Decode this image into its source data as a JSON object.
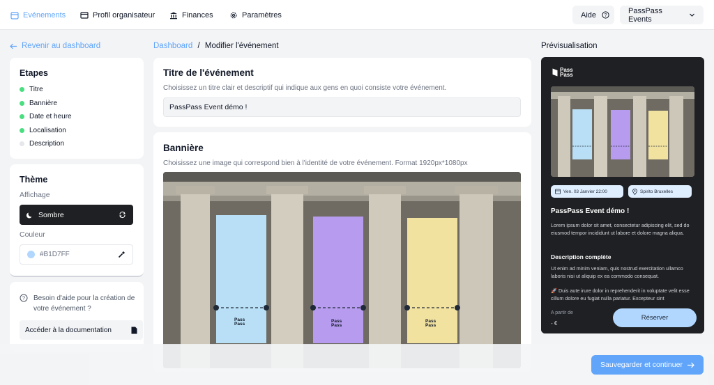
{
  "nav": {
    "items": [
      {
        "label": "Evénements",
        "icon": "calendar-icon",
        "active": true
      },
      {
        "label": "Profil organisateur",
        "icon": "profile-card-icon",
        "active": false
      },
      {
        "label": "Finances",
        "icon": "bank-icon",
        "active": false
      },
      {
        "label": "Paramètres",
        "icon": "gear-icon",
        "active": false
      }
    ],
    "help_label": "Aide",
    "account_label": "PassPass Events"
  },
  "sidebar": {
    "back_label": "Revenir au dashboard",
    "steps_title": "Etapes",
    "steps": [
      {
        "label": "Titre",
        "done": true
      },
      {
        "label": "Bannière",
        "done": true
      },
      {
        "label": "Date et heure",
        "done": true
      },
      {
        "label": "Localisation",
        "done": true
      },
      {
        "label": "Description",
        "done": false
      }
    ],
    "theme_title": "Thème",
    "display_label": "Affichage",
    "display_value": "Sombre",
    "color_label": "Couleur",
    "color_value": "#B1D7FF",
    "help_text": "Besoin d'aide pour la création de votre événement ?",
    "doc_button_label": "Accéder à la documentation"
  },
  "breadcrumb": {
    "link": "Dashboard",
    "separator": "/",
    "current": "Modifier l'événement"
  },
  "title_section": {
    "heading": "Titre de l'événement",
    "description": "Choisissez un titre clair et descriptif qui indique aux gens en quoi consiste votre événement.",
    "input_value": "PassPass Event démo !"
  },
  "banner_section": {
    "heading": "Bannière",
    "description": "Choisissez une image qui correspond bien à l'identité de votre événement. Format 1920px*1080px",
    "logo_text_1": "Pass",
    "logo_text_2": "Pass"
  },
  "preview": {
    "heading": "Prévisualisation",
    "logo_text_1": "Pass",
    "logo_text_2": "Pass",
    "date_chip": "Ven. 03 Janvier 22:00",
    "location_chip": "Spirito Bruxelles",
    "event_title": "PassPass Event démo !",
    "intro": "Lorem ipsum dolor sit amet, consectetur adipiscing elit, sed do eiusmod tempor incididunt ut labore et dolore magna aliqua.",
    "desc_title": "Description complète",
    "desc_1": "Ut enim ad minim veniam, quis nostrud exercitation ullamco laboris nisi ut aliquip ex ea commodo consequat.",
    "desc_2": "🚀 Duis aute irure dolor in reprehenderit in voluptate velit esse cillum dolore eu fugiat nulla pariatur. Excepteur sint",
    "price_label": "A partir de",
    "price_value": "- €",
    "reserve_label": "Réserver"
  },
  "footer": {
    "save_label": "Sauvegarder et continuer"
  },
  "colors": {
    "accent": "#60a5fa",
    "done_dot": "#4ade80",
    "pending_dot": "#e5e7eb",
    "theme_color": "#B1D7FF",
    "banner_blue": "#b8dff5",
    "banner_purple": "#b79bef",
    "banner_yellow": "#f2e2a0"
  }
}
